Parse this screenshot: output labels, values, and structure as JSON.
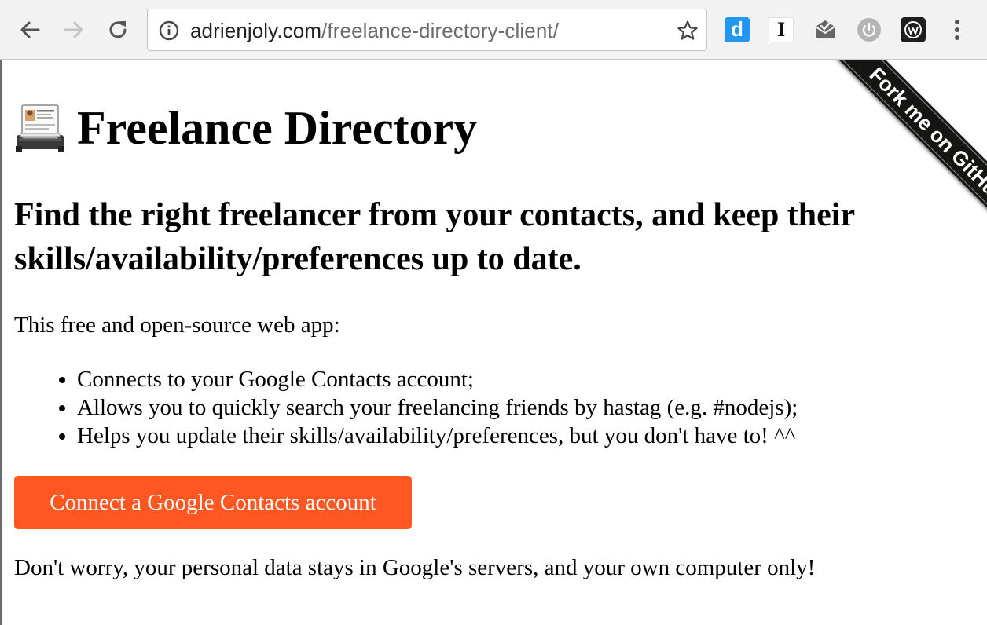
{
  "browser": {
    "url_domain": "adrienjoly.com",
    "url_path": "/freelance-directory-client/",
    "extensions": {
      "d_label": "d",
      "i_label": "I"
    }
  },
  "page": {
    "title": "Freelance Directory",
    "subtitle": "Find the right freelancer from your contacts, and keep their skills/availability/preferences up to date.",
    "intro": "This free and open-source web app:",
    "features": [
      "Connects to your Google Contacts account;",
      "Allows you to quickly search your freelancing friends by hastag (e.g. #nodejs);",
      "Helps you update their skills/availability/preferences, but you don't have to! ^^"
    ],
    "connect_button": "Connect a Google Contacts account",
    "privacy_note": "Don't worry, your personal data stays in Google's servers, and your own computer only!",
    "ribbon": "Fork me on GitHub"
  },
  "colors": {
    "button_bg": "#ff5722",
    "ribbon_bg": "#151513"
  }
}
